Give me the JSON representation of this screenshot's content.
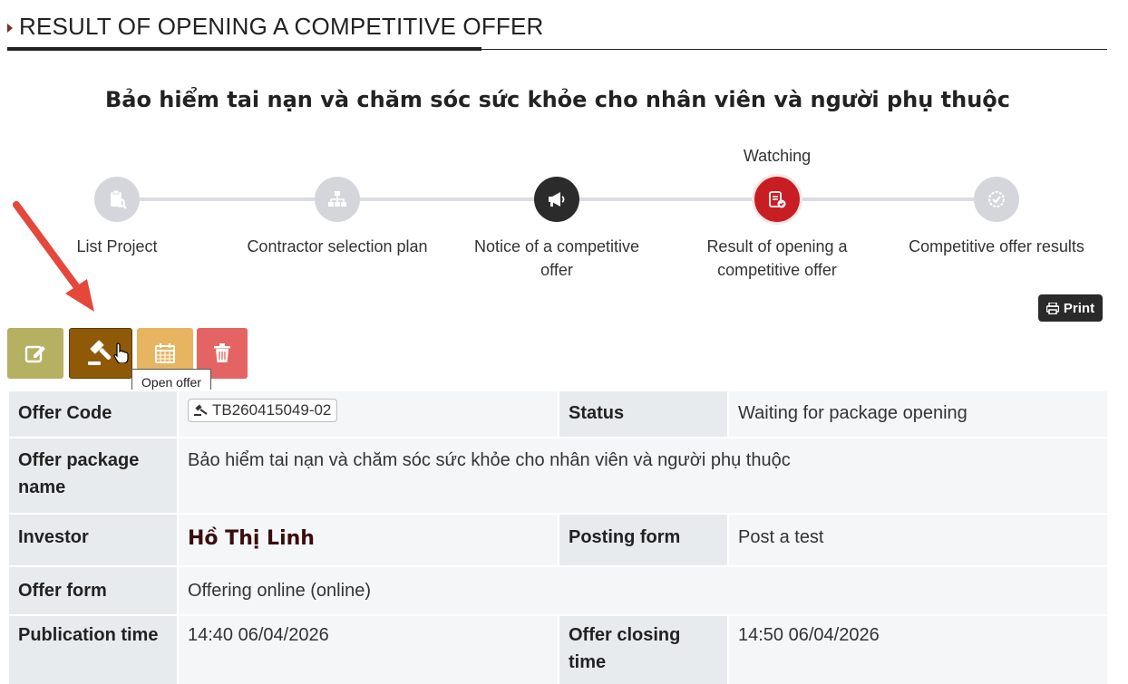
{
  "header": {
    "title": "RESULT OF OPENING A COMPETITIVE OFFER"
  },
  "package_title": "Bảo hiểm tai nạn và chăm sóc sức khỏe cho nhân viên và người phụ thuộc",
  "stepper": {
    "watching_label": "Watching",
    "steps": [
      {
        "label": "List Project",
        "icon": "clipboard-search-icon",
        "state": "default"
      },
      {
        "label": "Contractor selection plan",
        "icon": "org-chart-icon",
        "state": "default"
      },
      {
        "label": "Notice of a competitive offer",
        "icon": "megaphone-icon",
        "state": "done"
      },
      {
        "label": "Result of opening a competitive offer",
        "icon": "clipboard-check-icon",
        "state": "active"
      },
      {
        "label": "Competitive offer results",
        "icon": "verified-badge-icon",
        "state": "default"
      }
    ],
    "active_color": "#c81e23"
  },
  "print_label": "Print",
  "actions": {
    "edit_icon": "edit-icon",
    "open_icon": "gavel-icon",
    "schedule_icon": "calendar-icon",
    "delete_icon": "trash-icon",
    "tooltip": "Open offer"
  },
  "details": {
    "offer_code_label": "Offer Code",
    "offer_code": "TB260415049-02",
    "status_label": "Status",
    "status": "Waiting for package opening",
    "package_name_label": "Offer package name",
    "package_name": "Bảo hiểm tai nạn và chăm sóc sức khỏe cho nhân viên và người phụ thuộc",
    "investor_label": "Investor",
    "investor": "Hồ Thị Linh",
    "posting_form_label": "Posting form",
    "posting_form": "Post a test",
    "offer_form_label": "Offer form",
    "offer_form": "Offering online (online)",
    "publication_time_label": "Publication time",
    "publication_time": "14:40 06/04/2026",
    "closing_time_label": "Offer closing time",
    "closing_time": "14:50 06/04/2026"
  }
}
